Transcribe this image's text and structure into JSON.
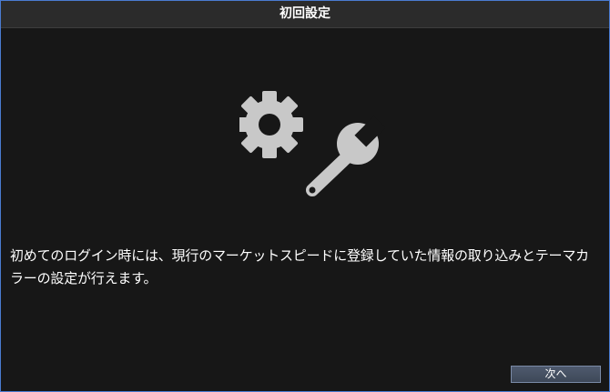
{
  "window": {
    "title": "初回設定"
  },
  "main": {
    "illustration_icon": "gear-wrench-icon",
    "message": "初めてのログイン時には、現行のマーケットスピードに登録していた情報の取り込みとテーマカラーの設定が行えます。"
  },
  "footer": {
    "next_label": "次へ"
  },
  "colors": {
    "background": "#171717",
    "titlebar": "#2b2b2b",
    "border": "#4a7bd0",
    "icon": "#c8c8c8",
    "button": "#465264"
  }
}
